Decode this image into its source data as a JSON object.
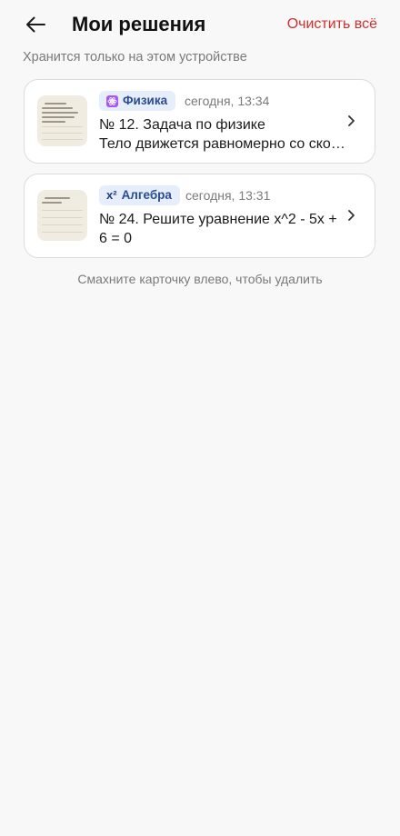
{
  "header": {
    "title": "Мои решения",
    "clear_label": "Очистить всё"
  },
  "subtitle": "Хранится только на этом устройстве",
  "solutions": [
    {
      "subject": "Физика",
      "subject_icon": "atom-icon",
      "subject_color": "#a855f7",
      "time": "сегодня, 13:34",
      "title": "№ 12. Задача по физике",
      "text": "Тело движется равномерно со скоро…",
      "thumbnail": "problem-photo-thumbnail"
    },
    {
      "subject": "Алгебра",
      "subject_icon": "x²",
      "time": "сегодня, 13:31",
      "title": "№ 24. Решите уравнение x^2 - 5x + 6 = 0",
      "thumbnail": "problem-photo-thumbnail"
    }
  ],
  "hint": "Смахните карточку влево, чтобы удалить",
  "colors": {
    "background": "#f8f8f8",
    "accent_red": "#d32f2f",
    "badge_bg": "#e6eefb",
    "badge_text": "#2a4b8d"
  }
}
